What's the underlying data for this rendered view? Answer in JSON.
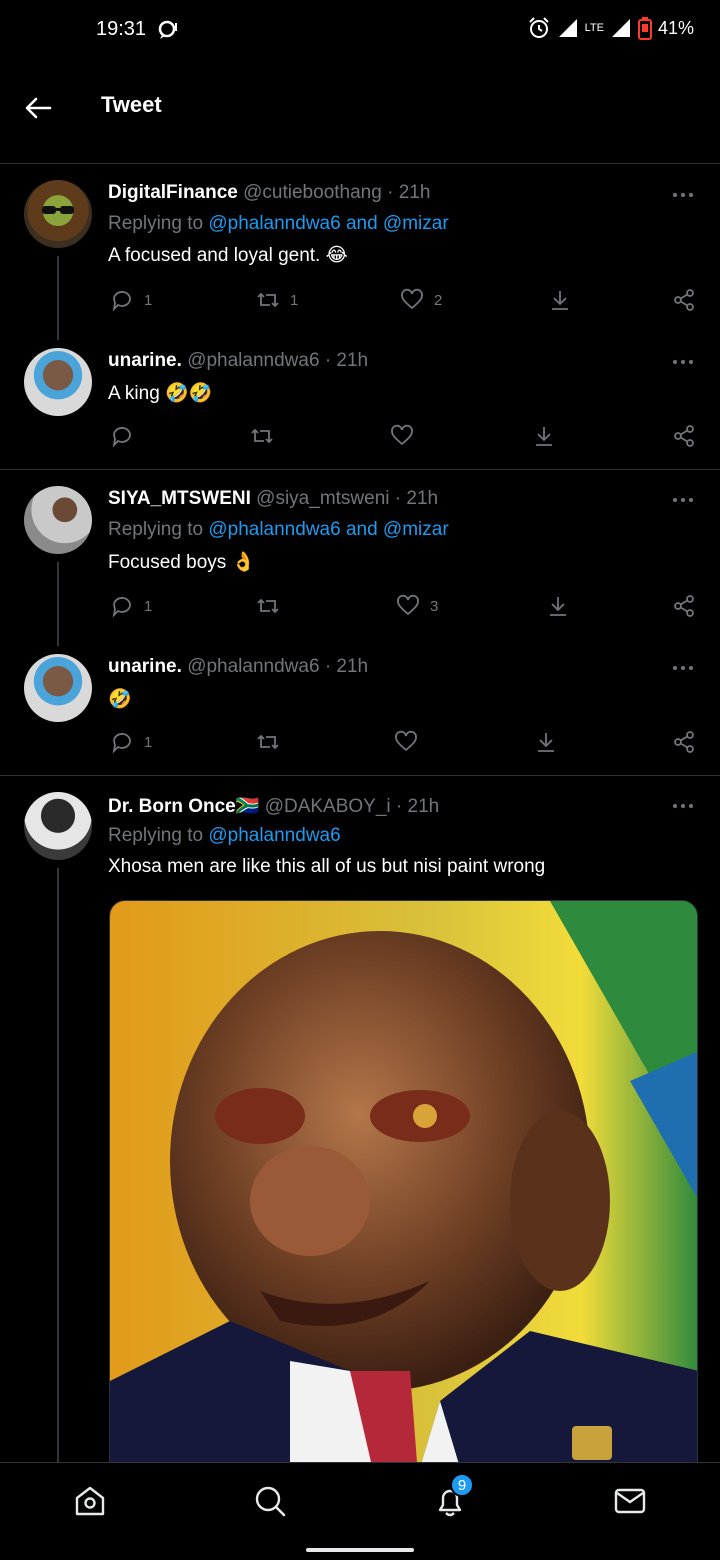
{
  "status_bar": {
    "time": "19:31",
    "network": "LTE",
    "battery": "41%"
  },
  "header": {
    "title": "Tweet"
  },
  "tweets": [
    {
      "name": "DigitalFinance",
      "handle": "@cutieboothang",
      "time": "· 21h",
      "replying_prefix": "Replying to ",
      "replying_to": "@phalanndwa6 and @mizar",
      "text": "A focused and loyal gent. 😂",
      "replies": "1",
      "retweets": "1",
      "likes": "2"
    },
    {
      "name": "unarine.",
      "handle": "@phalanndwa6",
      "time": "· 21h",
      "text": "A king 🤣🤣",
      "replies": "",
      "retweets": "",
      "likes": ""
    },
    {
      "name": "SIYA_MTSWENI",
      "handle": "@siya_mtsweni",
      "time": "· 21h",
      "replying_prefix": "Replying to ",
      "replying_to": "@phalanndwa6 and @mizar",
      "text": "Focused boys 👌",
      "replies": "1",
      "retweets": "",
      "likes": "3"
    },
    {
      "name": "unarine.",
      "handle": "@phalanndwa6",
      "time": "· 21h",
      "text": "🤣",
      "replies": "1",
      "retweets": "",
      "likes": ""
    },
    {
      "name": "Dr. Born Once🇿🇦",
      "handle": "@DAKABOY_i",
      "time": "· 21h",
      "replying_prefix": "Replying to ",
      "replying_to": "@phalanndwa6",
      "text": "Xhosa men are like this all of us but nisi paint wrong"
    }
  ],
  "bottom_nav": {
    "notification_count": "9"
  },
  "colors": {
    "accent": "#1d9bf0",
    "background": "#000000",
    "muted": "#71767b",
    "divider": "#2f3336"
  }
}
